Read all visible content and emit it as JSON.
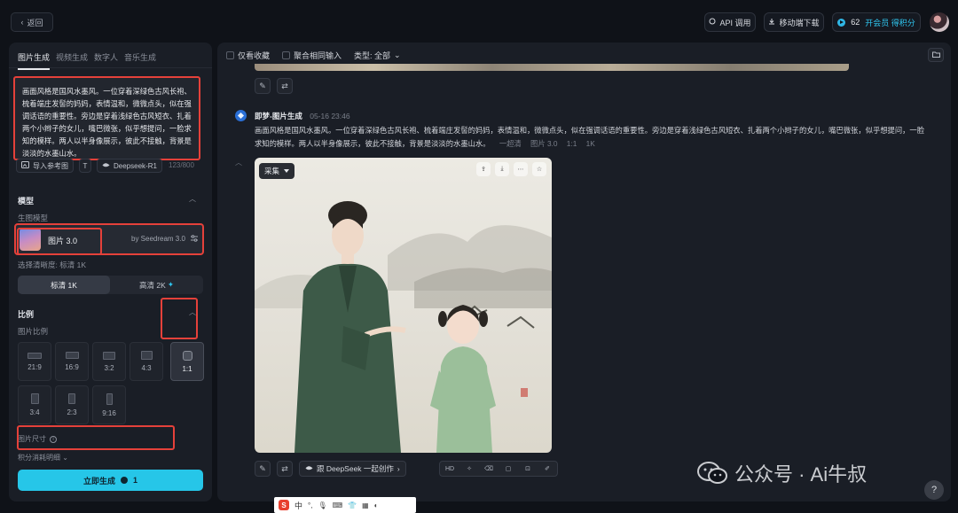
{
  "topbar": {
    "back": "返回",
    "api": "API 调用",
    "download": "移动端下载",
    "credits": "62",
    "vip": "开会员 得积分"
  },
  "left": {
    "tabs": [
      "图片生成",
      "视频生成",
      "数字人",
      "音乐生成"
    ],
    "prompt": "画面风格是国风水墨风。一位穿着深绿色古风长袍、梳着端庄发髻的妈妈，表情温和，微微点头，似在强调话语的重要性。旁边是穿着浅绿色古风短衣、扎着两个小辫子的女儿，嘴巴微张，似乎想提问，一脸求知的模样。两人以半身像展示，彼此不接触，背景是淡淡的水墨山水。",
    "import_ref": "导入参考图",
    "deepseek": "Deepseek-R1",
    "char_count": "123/800",
    "model_section": "模型",
    "gen_model_label": "生图模型",
    "model_name": "图片 3.0",
    "model_by": "by Seedream 3.0",
    "clarity_label": "选择清晰度: 标清 1K",
    "res_1k": "标清 1K",
    "res_2k": "高清 2K",
    "ratio_section": "比例",
    "ratio_label": "图片比例",
    "ratios": [
      "21:9",
      "16:9",
      "3:2",
      "4:3",
      "1:1",
      "3:4",
      "2:3",
      "9:16"
    ],
    "size_label": "图片尺寸",
    "credits_detail": "积分消耗明细",
    "generate": "立即生成",
    "generate_cost": "1"
  },
  "main": {
    "only_fav": "仅看收藏",
    "merge_input": "聚合相同输入",
    "type_filter": "类型: 全部",
    "sender": "即梦-图片生成",
    "time": "05-16  23:46",
    "message": "画面风格是国风水墨风。一位穿着深绿色古风长袍、梳着端庄发髻的妈妈，表情温和，微微点头，似在强调话语的重要性。旁边是穿着浅绿色古风短衣、扎着两个小辫子的女儿，嘴巴微张，似乎想提问，一脸求知的模样。两人以半身像展示，彼此不接触，背景是淡淡的水墨山水。",
    "meta_mode": "一超清",
    "meta_model": "图片 3.0",
    "meta_ratio": "1:1",
    "meta_res": "1K",
    "collect": "采集",
    "deepseek_create": "跟 DeepSeek 一起创作",
    "hd": "HD"
  },
  "watermark": {
    "text": "公众号 · Ai牛叔"
  },
  "ime": {
    "lang": "中"
  },
  "colors": {
    "accent": "#26c6e8",
    "highlight": "#e5413a",
    "panel": "#1a1e26",
    "background": "#0f1218"
  }
}
